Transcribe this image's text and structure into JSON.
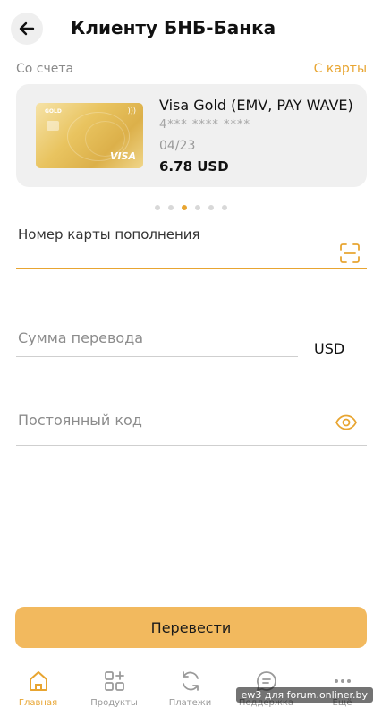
{
  "header": {
    "title": "Клиенту БНБ-Банка"
  },
  "from": {
    "label": "Со счета",
    "switch_label": "С карты"
  },
  "card": {
    "name": "Visa Gold (EMV, PAY WAVE)",
    "number": "4*** **** ****",
    "expiry": "04/23",
    "balance": "6.78 USD",
    "image_label": "GOLD",
    "image_brand": "VISA"
  },
  "carousel": {
    "total": 6,
    "active_index": 2
  },
  "fields": {
    "card_number": {
      "label": "Номер карты пополнения"
    },
    "amount": {
      "label": "Сумма перевода",
      "currency": "USD"
    },
    "code": {
      "label": "Постоянный код"
    }
  },
  "submit_label": "Перевести",
  "tabbar": {
    "items": [
      {
        "label": "Главная",
        "icon": "home-icon",
        "active": true
      },
      {
        "label": "Продукты",
        "icon": "products-icon",
        "active": false
      },
      {
        "label": "Платежи",
        "icon": "payments-icon",
        "active": false
      },
      {
        "label": "Поддержка",
        "icon": "support-icon",
        "active": false
      },
      {
        "label": "Ещё",
        "icon": "more-icon",
        "active": false
      }
    ]
  },
  "watermark": "ew3 для forum.onliner.by",
  "colors": {
    "accent": "#e8a531",
    "button": "#f2b95e"
  }
}
